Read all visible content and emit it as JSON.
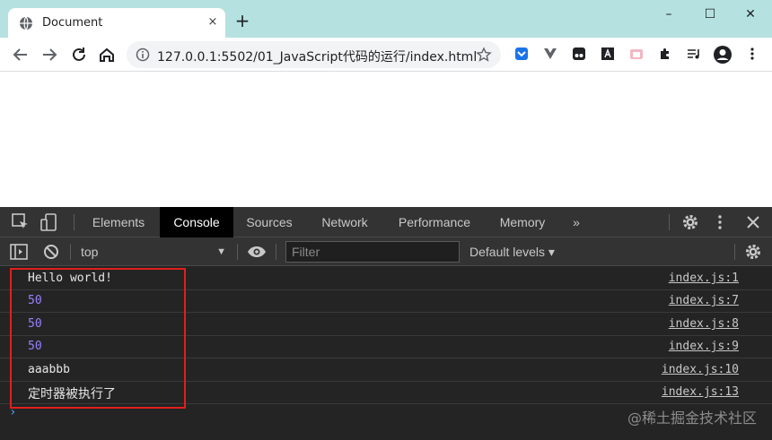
{
  "browser": {
    "tab": {
      "title": "Document",
      "favicon": "globe-icon",
      "close_label": "×"
    },
    "new_tab_label": "+",
    "window_controls": {
      "minimize": "–",
      "maximize": "☐",
      "close": "✕"
    },
    "address": {
      "host": "127.0.0.1",
      "rest": ":5502/01_JavaScript代码的运行/index.html"
    },
    "icons": [
      "back-arrow-icon",
      "forward-arrow-icon",
      "reload-icon",
      "home-icon",
      "info-icon",
      "star-icon",
      "extension-icons",
      "puzzle-icon",
      "media-icon",
      "profile-icon",
      "more-icon"
    ]
  },
  "devtools": {
    "tabs": [
      {
        "label": "Elements",
        "active": false
      },
      {
        "label": "Console",
        "active": true
      },
      {
        "label": "Sources",
        "active": false
      },
      {
        "label": "Network",
        "active": false
      },
      {
        "label": "Performance",
        "active": false
      },
      {
        "label": "Memory",
        "active": false
      }
    ],
    "overflow_label": "»",
    "console_bar": {
      "context": "top",
      "filter_placeholder": "Filter",
      "levels": "Default levels ▾"
    },
    "logs": [
      {
        "message": "Hello world!",
        "kind": "text",
        "source": "index.js:1"
      },
      {
        "message": "50",
        "kind": "num",
        "source": "index.js:7"
      },
      {
        "message": "50",
        "kind": "num",
        "source": "index.js:8"
      },
      {
        "message": "50",
        "kind": "num",
        "source": "index.js:9"
      },
      {
        "message": "aaabbb",
        "kind": "text",
        "source": "index.js:10"
      },
      {
        "message": "定时器被执行了",
        "kind": "cjk",
        "source": "index.js:13"
      }
    ],
    "prompt": "›",
    "colors": {
      "number": "#9980ff",
      "highlight": "#e0201d",
      "prompt": "#4d9df0"
    }
  },
  "watermark": "@稀土掘金技术社区"
}
